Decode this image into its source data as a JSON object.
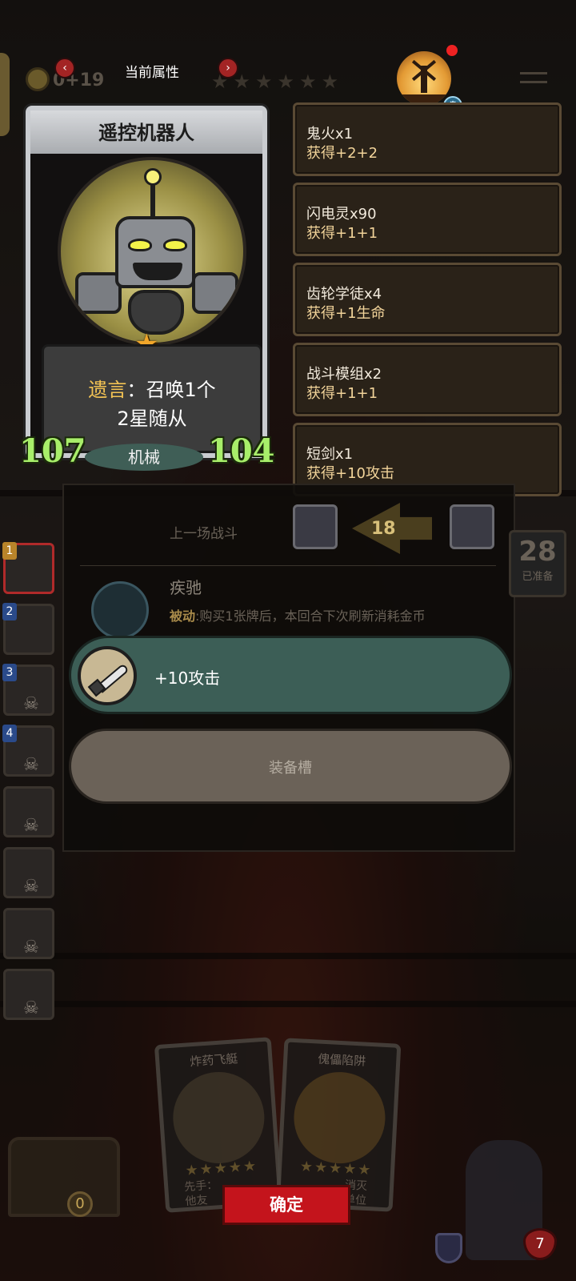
{
  "topbar": {
    "gold_text": "0+19",
    "title": "当前属性",
    "prev_icon": "‹",
    "next_icon": "›",
    "stars": "★★★★★★"
  },
  "card": {
    "name": "遥控机器人",
    "deathrattle_keyword": "遗言",
    "deathrattle_text_1": "：召唤1个",
    "deathrattle_text_2": "2星随从",
    "attack": "107",
    "health": "104",
    "tribe": "机械",
    "star": "★"
  },
  "buffs": [
    {
      "name": "鬼火x1",
      "gain": "获得+2+2"
    },
    {
      "name": "闪电灵x90",
      "gain": "获得+1+1"
    },
    {
      "name": "齿轮学徒x4",
      "gain": "获得+1生命"
    },
    {
      "name": "战斗模组x2",
      "gain": "获得+1+1"
    },
    {
      "name": "短剑x1",
      "gain": "获得+10攻击"
    }
  ],
  "panel": {
    "last_fight_label": "上一场战斗",
    "arrow_number": "18",
    "skill_name": "疾驰",
    "skill_keyword": "被动",
    "skill_desc": ":购买1张牌后，本回合下次刷新消耗金币"
  },
  "counter": {
    "value": "28",
    "label": "已准备"
  },
  "equip": {
    "label": "+10攻击",
    "slot_label": "装备槽"
  },
  "lineup": [
    {
      "index": "1"
    },
    {
      "index": "2"
    },
    {
      "index": "3"
    },
    {
      "index": "4"
    }
  ],
  "hand": [
    {
      "title": "炸药飞艇",
      "text": "先手：\n他友"
    },
    {
      "title": "傀儡陷阱",
      "text": "消灭\n单位"
    }
  ],
  "confirm_label": "确定",
  "chest_count": "0",
  "hero_health": "7",
  "skull_glyph": "☠"
}
